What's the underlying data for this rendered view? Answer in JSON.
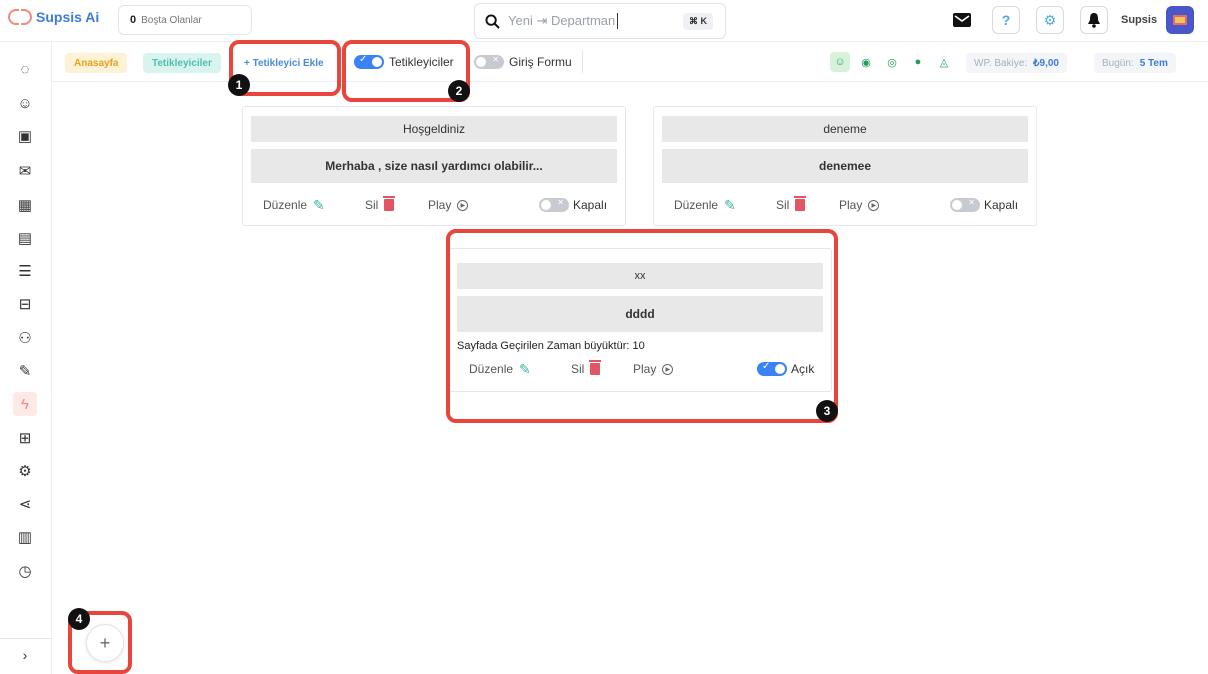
{
  "app": {
    "name": "Supsis Ai"
  },
  "topbar": {
    "idle_count": "0",
    "idle_label": "Boşta Olanlar",
    "search_placeholder": "Yeni ⇥ Departman",
    "search_shortcut": "⌘ K",
    "username": "Supsis"
  },
  "breadcrumbs": {
    "home": "Anasayfa",
    "triggers": "Tetikleyiciler"
  },
  "toolbar": {
    "add_trigger": "+ Tetikleyici Ekle",
    "triggers_toggle_label": "Tetikleyiciler",
    "triggers_toggle_on": true,
    "login_form_toggle_label": "Giriş Formu",
    "login_form_toggle_on": false,
    "wp_balance_label": "WP. Bakiye:",
    "wp_balance_value": "₺9,00",
    "today_label": "Bugün:",
    "today_value": "5 Tem"
  },
  "cards": [
    {
      "title": "Hoşgeldiniz",
      "message": "Merhaba , size nasıl yardımcı olabilir...",
      "condition": "",
      "edit": "Düzenle",
      "delete": "Sil",
      "play": "Play",
      "status_label": "Kapalı",
      "active": false
    },
    {
      "title": "deneme",
      "message": "denemee",
      "condition": "",
      "edit": "Düzenle",
      "delete": "Sil",
      "play": "Play",
      "status_label": "Kapalı",
      "active": false
    },
    {
      "title": "xx",
      "message": "dddd",
      "condition": "Sayfada Geçirilen Zaman büyüktür: 10",
      "edit": "Düzenle",
      "delete": "Sil",
      "play": "Play",
      "status_label": "Açık",
      "active": true
    }
  ],
  "annotations": [
    "1",
    "2",
    "3",
    "4"
  ],
  "fab": {
    "label": "+"
  },
  "colors": {
    "annotation": "#e8453c",
    "brand_blue": "#3d7bd9",
    "active_toggle": "#3b82f6"
  }
}
